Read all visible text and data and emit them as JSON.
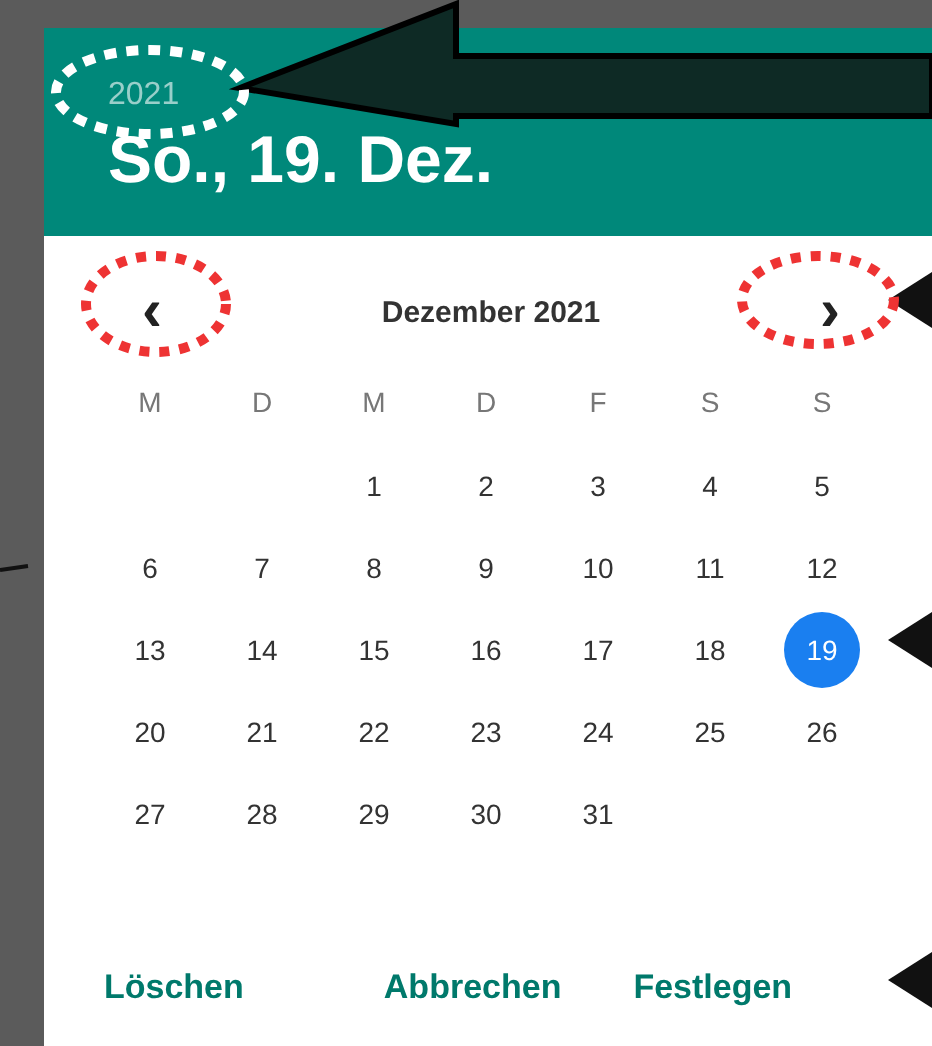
{
  "header": {
    "year": "2021",
    "date": "So., 19. Dez."
  },
  "calendar": {
    "prev": "‹",
    "next": "›",
    "month": "Dezember 2021",
    "weekdays": [
      "M",
      "D",
      "M",
      "D",
      "F",
      "S",
      "S"
    ],
    "weeks": [
      [
        {
          "day": "1",
          "selected": false
        },
        {
          "day": "2",
          "selected": false
        },
        {
          "day": "3",
          "selected": false
        },
        {
          "day": "4",
          "selected": false
        },
        {
          "day": "5",
          "selected": false
        }
      ],
      [
        {
          "day": "6",
          "selected": false
        },
        {
          "day": "7",
          "selected": false
        },
        {
          "day": "8",
          "selected": false
        },
        {
          "day": "9",
          "selected": false
        },
        {
          "day": "10",
          "selected": false
        },
        {
          "day": "11",
          "selected": false
        },
        {
          "day": "12",
          "selected": false
        }
      ],
      [
        {
          "day": "13",
          "selected": false
        },
        {
          "day": "14",
          "selected": false
        },
        {
          "day": "15",
          "selected": false
        },
        {
          "day": "16",
          "selected": false
        },
        {
          "day": "17",
          "selected": false
        },
        {
          "day": "18",
          "selected": false
        },
        {
          "day": "19",
          "selected": true
        }
      ],
      [
        {
          "day": "20",
          "selected": false
        },
        {
          "day": "21",
          "selected": false
        },
        {
          "day": "22",
          "selected": false
        },
        {
          "day": "23",
          "selected": false
        },
        {
          "day": "24",
          "selected": false
        },
        {
          "day": "25",
          "selected": false
        },
        {
          "day": "26",
          "selected": false
        }
      ],
      [
        {
          "day": "27",
          "selected": false
        },
        {
          "day": "28",
          "selected": false
        },
        {
          "day": "29",
          "selected": false
        },
        {
          "day": "30",
          "selected": false
        },
        {
          "day": "31",
          "selected": false
        }
      ]
    ]
  },
  "buttons": [
    "Löschen",
    "Abbrechen",
    "Festlegen"
  ]
}
